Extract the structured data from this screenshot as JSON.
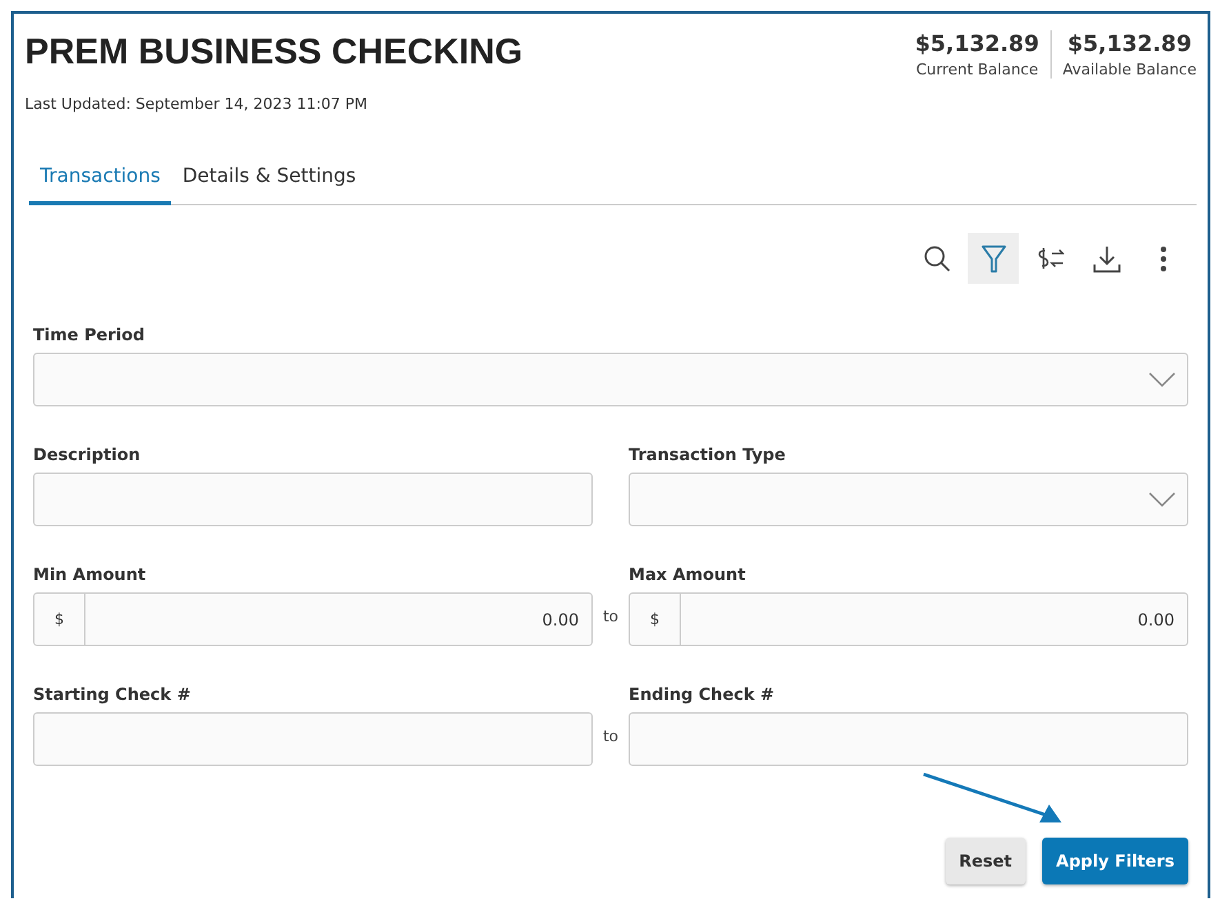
{
  "account": {
    "title": "PREM BUSINESS CHECKING",
    "last_updated": "Last Updated: September 14, 2023 11:07 PM"
  },
  "balances": [
    {
      "amount": "$5,132.89",
      "label": "Current Balance"
    },
    {
      "amount": "$5,132.89",
      "label": "Available Balance"
    }
  ],
  "tabs": [
    {
      "label": "Transactions",
      "selected": true
    },
    {
      "label": "Details & Settings",
      "selected": false
    }
  ],
  "toolbar": [
    {
      "kind": "search",
      "selected": false
    },
    {
      "kind": "filter",
      "selected": true
    },
    {
      "kind": "transfer",
      "selected": false
    },
    {
      "kind": "download",
      "selected": false
    },
    {
      "kind": "more",
      "selected": false
    }
  ],
  "filter_rows": [
    {
      "fields": [
        {
          "kind": "select",
          "label": "Time Period"
        }
      ]
    },
    {
      "fields": [
        {
          "kind": "text",
          "label": "Description"
        },
        {
          "kind": "select",
          "label": "Transaction Type"
        }
      ]
    },
    {
      "separator": "to",
      "fields": [
        {
          "kind": "amount",
          "label": "Min Amount",
          "prefix": "$",
          "value": "0.00"
        },
        {
          "kind": "amount",
          "label": "Max Amount",
          "prefix": "$",
          "value": "0.00"
        }
      ]
    },
    {
      "separator": "to",
      "fields": [
        {
          "kind": "text",
          "label": "Starting Check #"
        },
        {
          "kind": "text",
          "label": "Ending Check #"
        }
      ]
    }
  ],
  "buttons": [
    {
      "label": "Reset",
      "kind": "secondary"
    },
    {
      "label": "Apply Filters",
      "kind": "primary"
    }
  ]
}
